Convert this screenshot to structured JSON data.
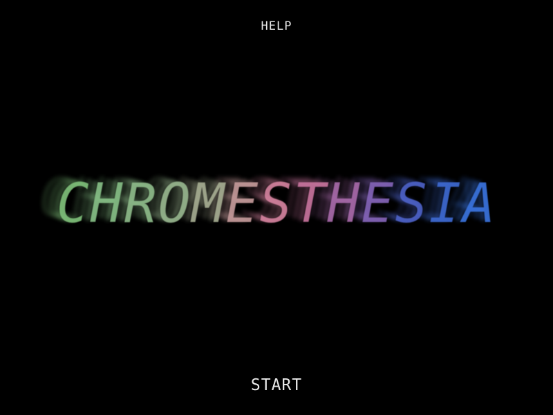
{
  "menu": {
    "help_label": "HELP",
    "start_label": "START"
  },
  "title": {
    "text": "CHROMESTHESIA",
    "letter_colors": [
      "#7fc07a",
      "#86bf86",
      "#8ebb8a",
      "#97b68e",
      "#a6ad92",
      "#c49a9a",
      "#d4829e",
      "#c8749e",
      "#a86aaa",
      "#8464b8",
      "#4d62c8",
      "#3e6ad2",
      "#3a73de"
    ]
  },
  "colors": {
    "background": "#000000",
    "menu_text": "#e8e8e8"
  }
}
